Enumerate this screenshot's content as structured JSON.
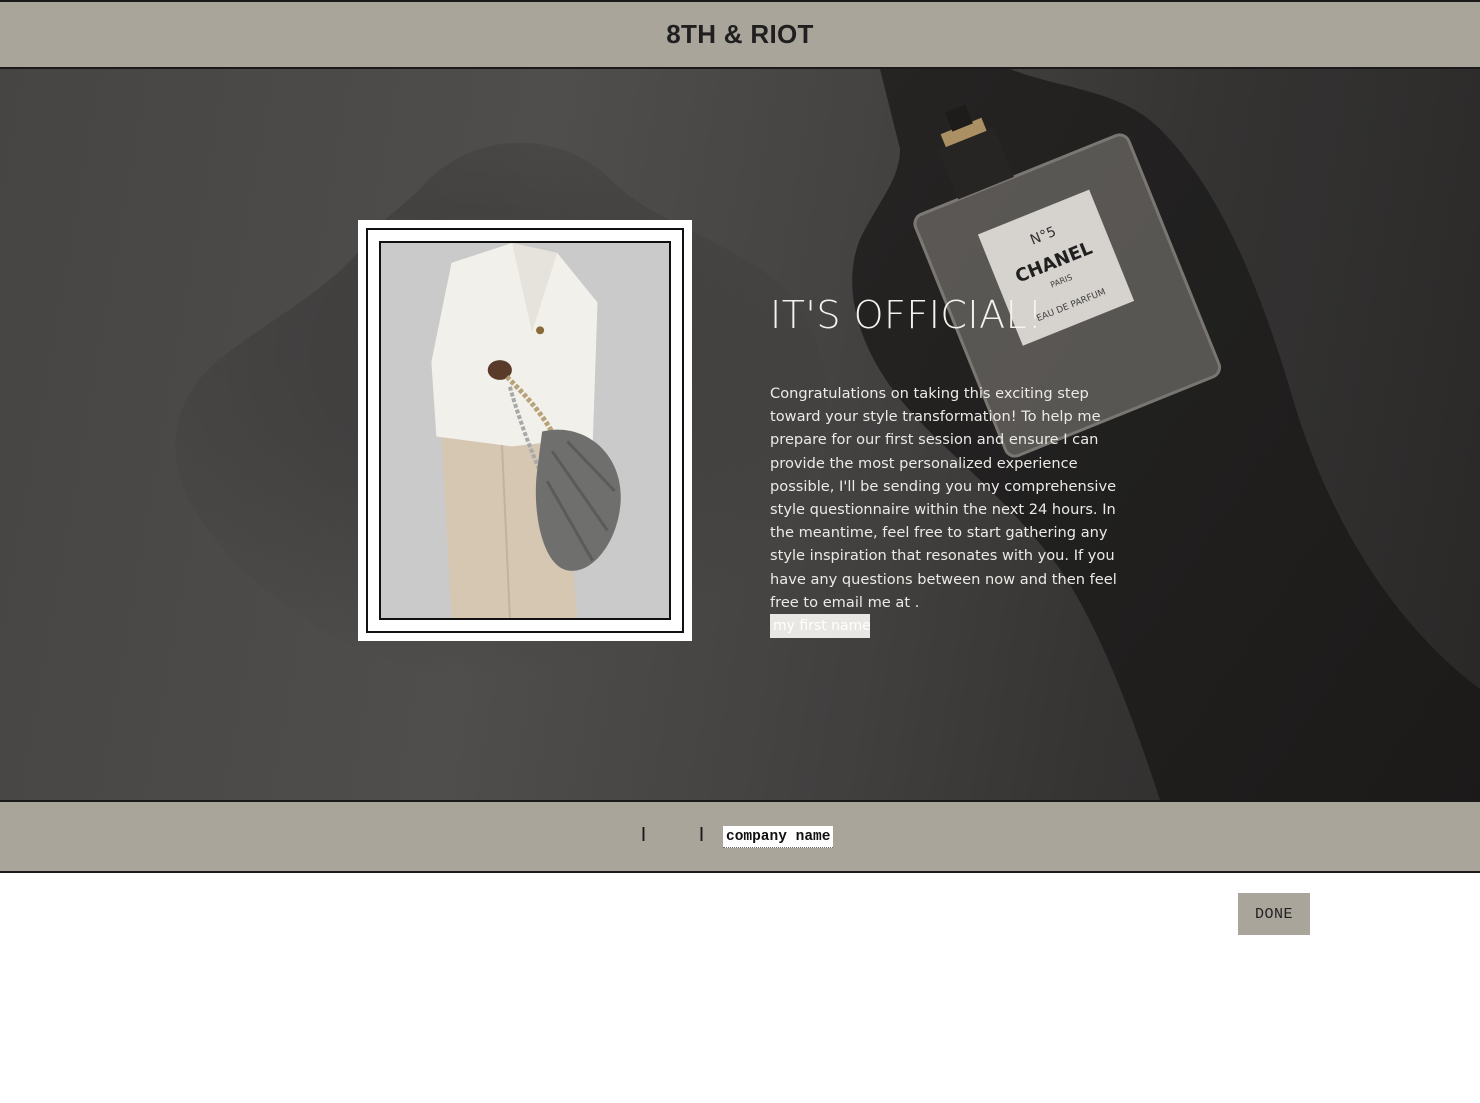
{
  "header": {
    "brand": "8TH & RIOT"
  },
  "hero": {
    "title": "IT'S OFFICIAL!",
    "body": "Congratulations on taking this exciting step toward your style transformation! To help me prepare for our first session and ensure I can provide the most personalized experience possible, I'll be sending you my comprehensive style questionnaire within the next 24 hours. In the meantime, feel free to start gathering any style inspiration that resonates with you. If you have any questions between now and then feel free to email me at .",
    "name_field": "my first name",
    "bottle_label": {
      "line1": "N°5",
      "line2": "CHANEL",
      "line3": "PARIS",
      "line4": "EAU DE PARFUM"
    }
  },
  "footer": {
    "separator": "|",
    "company_field": "company name"
  },
  "actions": {
    "done_label": "DONE"
  },
  "colors": {
    "bar": "#aaa59b",
    "border": "#1a1a1a",
    "accent_text": "#f4f2ee"
  }
}
